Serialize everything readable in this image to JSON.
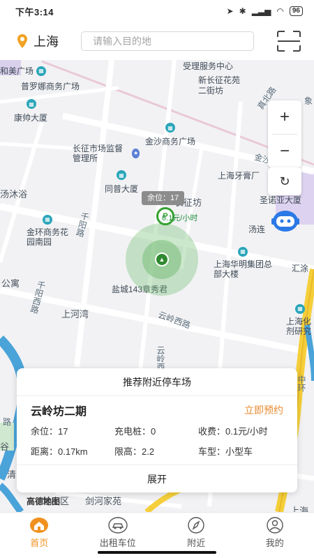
{
  "status": {
    "time": "下午3:14",
    "battery": "96"
  },
  "header": {
    "city": "上海",
    "search_placeholder": "请输入目的地"
  },
  "map": {
    "pois": [
      "和美广场",
      "普罗娜商务广场",
      "康帅大厦",
      "金沙商务广场",
      "长征市场监督管理所",
      "同普大厦",
      "上海牙膏厂",
      "圣诺亚大厦",
      "金环商务花园南园",
      "汤连",
      "上海华明集团总部大楼",
      "汇涂",
      "盐城143章秀君",
      "上海化剂研究",
      "受理服务中心",
      "新长征花苑二街坊",
      "长征坊"
    ],
    "areas": [
      "汤沐浴",
      "公寓",
      "上河湾",
      "剑河家苑",
      "清",
      "谷",
      "甘小区",
      "上海"
    ],
    "roads": [
      "金沙江路",
      "真北路",
      "千阳路",
      "千阳西路",
      "云岭西路",
      "云岭西",
      "中环",
      "路",
      "象"
    ],
    "spot_tag": "余位：17",
    "spot_marker": "P",
    "spot_price": "0.1元/小时",
    "logo": "高德地图"
  },
  "controls": {
    "zoom_in": "+",
    "zoom_out": "−",
    "refresh": "↻"
  },
  "card": {
    "title": "推荐附近停车场",
    "lot_name": "云岭坊二期",
    "reserve": "立即预约",
    "spaces": "余位：17",
    "chargers": "充电桩：0",
    "fee": "收费：0.1元/小时",
    "distance": "距离：0.17km",
    "height_limit": "限高：2.2",
    "vehicle_type": "车型：小型车",
    "expand": "展开"
  },
  "tabs": [
    {
      "label": "首页",
      "icon": "home-icon",
      "active": true
    },
    {
      "label": "出租车位",
      "icon": "car-icon",
      "active": false
    },
    {
      "label": "附近",
      "icon": "compass-icon",
      "active": false
    },
    {
      "label": "我的",
      "icon": "user-icon",
      "active": false
    }
  ],
  "colors": {
    "accent": "#f0911f",
    "reserve": "#e88a2e",
    "road_yellow": "#f5cf3a",
    "river": "#4aa3d9"
  }
}
